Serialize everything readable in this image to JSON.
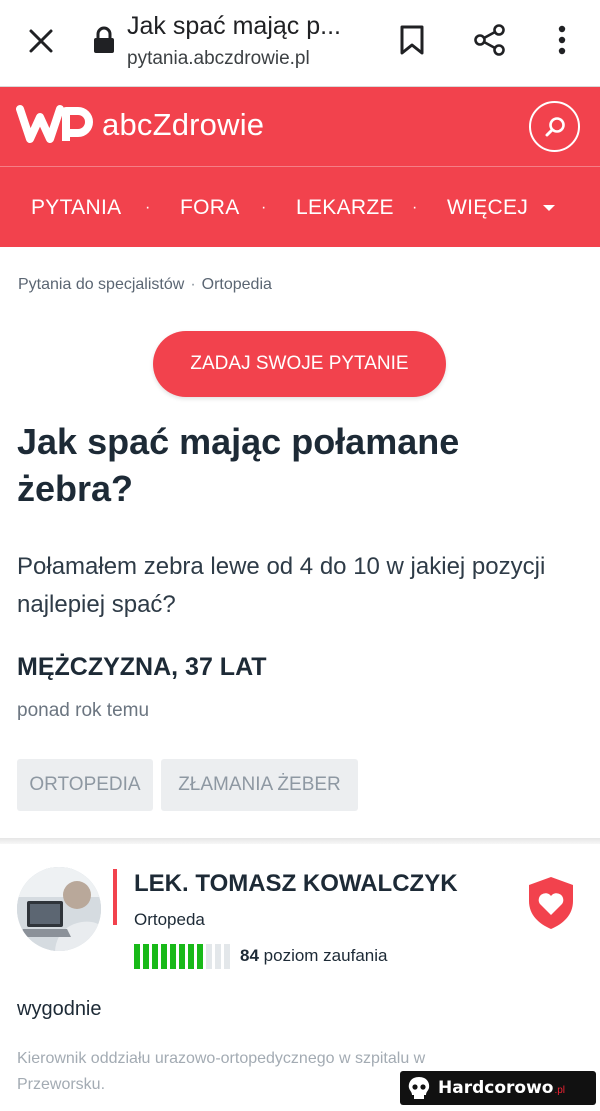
{
  "browser": {
    "title": "Jak spać mając p...",
    "url": "pytania.abczdrowie.pl"
  },
  "site": {
    "logo_text": "abcZdrowie",
    "nav": [
      "PYTANIA",
      "FORA",
      "LEKARZE",
      "WIĘCEJ"
    ],
    "nav_separator": "·",
    "brand_color": "#f2424d"
  },
  "breadcrumb": {
    "items": [
      "Pytania do specjalistów",
      "Ortopedia"
    ],
    "separator": "·"
  },
  "ask_button": "ZADAJ SWOJE PYTANIE",
  "question": {
    "title": "Jak spać mając połamane żebra?",
    "body": "Połamałem zebra lewe od 4 do 10 w jakiej pozycji najlepiej spać?",
    "author": "MĘŻCZYZNA, 37 LAT",
    "time": "ponad rok temu",
    "tags": [
      "ORTOPEDIA",
      "ZŁAMANIA ŻEBER"
    ]
  },
  "answer": {
    "doctor_name": "LEK. TOMASZ KOWALCZYK",
    "specialty": "Ortopeda",
    "trust_score": "84",
    "trust_label": "poziom zaufania",
    "trust_fraction": 0.84,
    "text": "wygodnie",
    "doctor_description": "Kierownik oddziału urazowo-ortopedycznego w szpitalu w Przeworsku."
  },
  "watermark": {
    "text": "Hardcorowo",
    "suffix": ".pl"
  }
}
